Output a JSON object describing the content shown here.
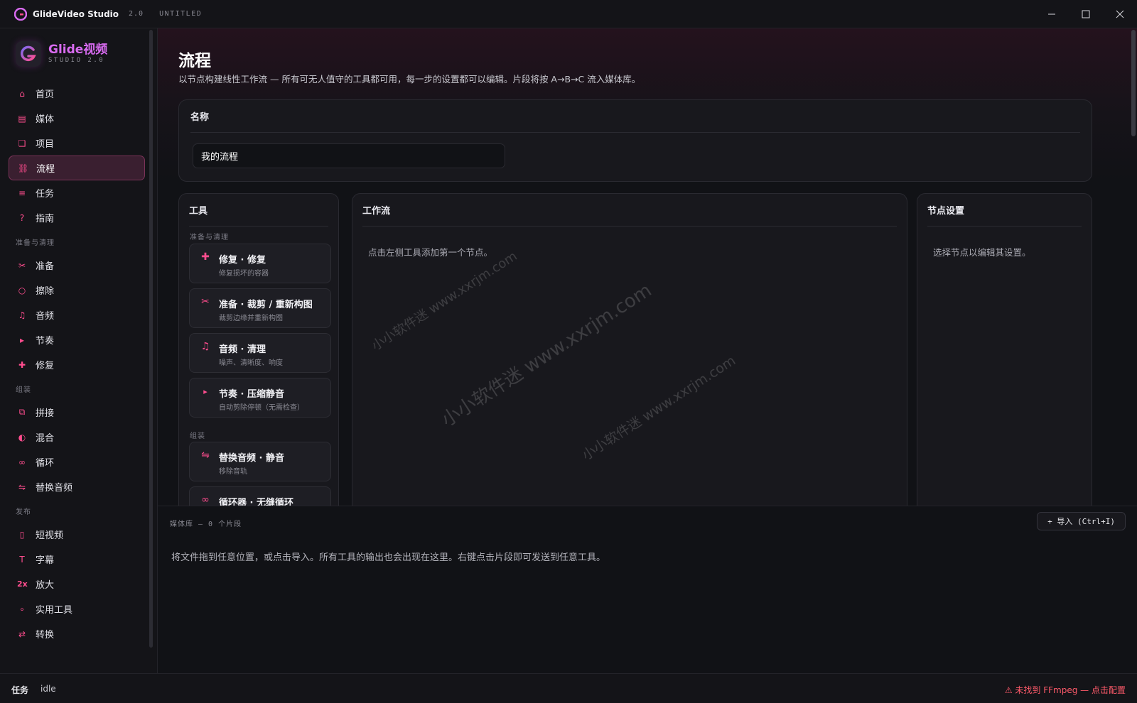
{
  "app": {
    "name": "GlideVideo Studio",
    "version": "2.0",
    "document": "UNTITLED"
  },
  "brand": {
    "name": "Glide视频",
    "subtitle": "STUDIO 2.0"
  },
  "colors": {
    "accent": "#ff4d8e",
    "brand": "#d86bf0",
    "warning": "#ff5a6a"
  },
  "sidebar": {
    "items": [
      {
        "label": "首页",
        "icon": "home-icon"
      },
      {
        "label": "媒体",
        "icon": "media-icon"
      },
      {
        "label": "项目",
        "icon": "project-icon"
      },
      {
        "label": "流程",
        "icon": "flow-icon",
        "active": true
      },
      {
        "label": "任务",
        "icon": "list-icon"
      },
      {
        "label": "指南",
        "icon": "question-icon"
      }
    ],
    "groups": [
      {
        "title": "准备与清理",
        "items": [
          {
            "label": "准备",
            "icon": "scissors-icon"
          },
          {
            "label": "擦除",
            "icon": "circle-icon"
          },
          {
            "label": "音频",
            "icon": "music-icon"
          },
          {
            "label": "节奏",
            "icon": "play-icon"
          },
          {
            "label": "修复",
            "icon": "plus-icon"
          }
        ]
      },
      {
        "title": "组装",
        "items": [
          {
            "label": "拼接",
            "icon": "merge-icon"
          },
          {
            "label": "混合",
            "icon": "half-circle-icon"
          },
          {
            "label": "循环",
            "icon": "infinity-icon"
          },
          {
            "label": "替换音频",
            "icon": "swap-icon"
          }
        ]
      },
      {
        "title": "发布",
        "items": [
          {
            "label": "短视频",
            "icon": "phone-icon"
          },
          {
            "label": "字幕",
            "icon": "text-icon"
          },
          {
            "label": "放大",
            "icon": "upscale-icon"
          },
          {
            "label": "实用工具",
            "icon": "dot-icon"
          },
          {
            "label": "转换",
            "icon": "convert-icon"
          }
        ]
      }
    ]
  },
  "page": {
    "title": "流程",
    "description": "以节点构建线性工作流 — 所有可无人值守的工具都可用，每一步的设置都可以编辑。片段将按 A→B→C 流入媒体库。"
  },
  "name_card": {
    "label": "名称",
    "value": "我的流程"
  },
  "tools_panel": {
    "title": "工具",
    "sections": [
      {
        "title": "准备与清理",
        "tools": [
          {
            "title": "修复 · 修复",
            "subtitle": "修复损坏的容器",
            "icon": "plus-icon"
          },
          {
            "title": "准备 · 裁剪 / 重新构图",
            "subtitle": "裁剪边缘并重新构图",
            "icon": "scissors-icon"
          },
          {
            "title": "音频 · 清理",
            "subtitle": "噪声、清晰度、响度",
            "icon": "music-icon"
          },
          {
            "title": "节奏 · 压缩静音",
            "subtitle": "自动剪除停顿（无需检查）",
            "icon": "play-icon"
          }
        ]
      },
      {
        "title": "组装",
        "tools": [
          {
            "title": "替换音频 · 静音",
            "subtitle": "移除音轨",
            "icon": "swap-icon"
          },
          {
            "title": "循环器 · 无缝循环",
            "subtitle": "",
            "icon": "infinity-icon"
          }
        ]
      }
    ]
  },
  "workflow_panel": {
    "title": "工作流",
    "hint": "点击左侧工具添加第一个节点。"
  },
  "node_settings_panel": {
    "title": "节点设置",
    "hint": "选择节点以编辑其设置。"
  },
  "media_library": {
    "label": "媒体库 — 0 个片段",
    "import_label": "+ 导入 (Ctrl+I)",
    "hint": "将文件拖到任意位置，或点击导入。所有工具的输出也会出现在这里。右键点击片段即可发送到任意工具。"
  },
  "statusbar": {
    "label": "任务",
    "value": "idle",
    "warning": "⚠ 未找到 FFmpeg — 点击配置"
  },
  "watermarks": [
    "小小软件迷 www.xxrjm.com",
    "小小软件迷 www.xxrjm.com",
    "小小软件迷 www.xxrjm.com"
  ]
}
